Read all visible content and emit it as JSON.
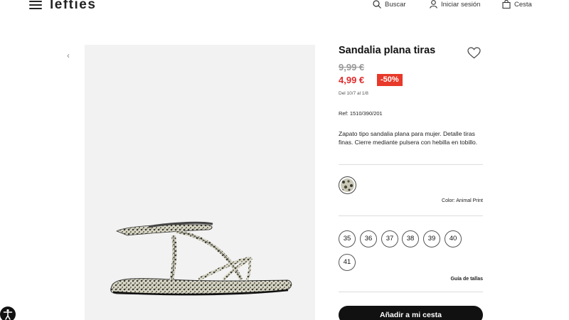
{
  "header": {
    "logo": "lefties",
    "search_label": "Buscar",
    "login_label": "Iniciar sesión",
    "cart_label": "Cesta"
  },
  "product": {
    "title": "Sandalia plana tiras",
    "old_price": "9,99 €",
    "new_price": "4,99 €",
    "discount": "-50%",
    "delivery": "Del 10/7 al 1/8",
    "ref": "Ref: 1510/390/201",
    "description": "Zapato tipo sandalia plana para mujer. Detalle tiras finas. Cierre mediante pulsera con hebilla en tobillo.",
    "color_label": "Color: Animal Print",
    "sizes": [
      "35",
      "36",
      "37",
      "38",
      "39",
      "40",
      "41"
    ],
    "size_guide": "Guía de tallas",
    "add_to_cart": "Añadir a mi cesta"
  },
  "colors": {
    "price_red": "#e02b2b",
    "badge_red": "#e8392a",
    "button_black": "#111111"
  }
}
